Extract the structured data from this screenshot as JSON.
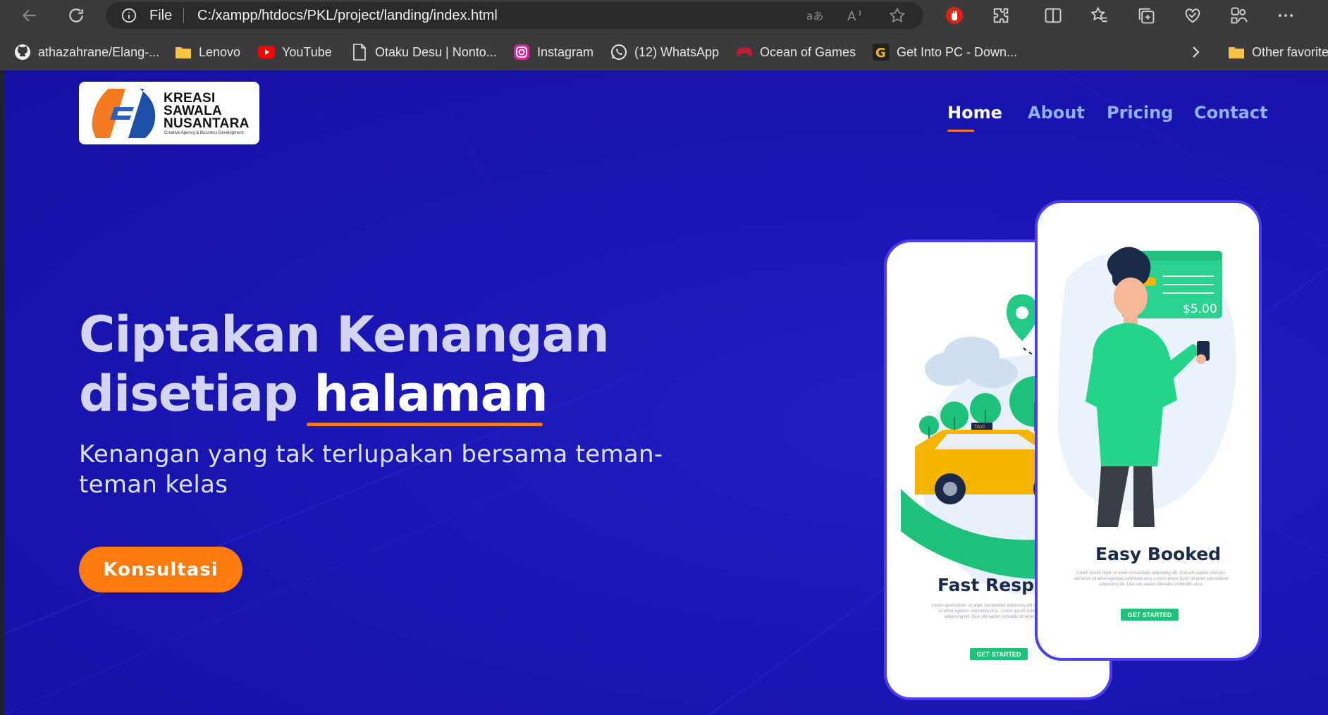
{
  "browser": {
    "protocol_label": "File",
    "url": "C:/xampp/htdocs/PKL/project/landing/index.html",
    "bookmarks": [
      {
        "label": "athazahrane/Elang-...",
        "icon": "github-icon"
      },
      {
        "label": "Lenovo",
        "icon": "folder-icon"
      },
      {
        "label": "YouTube",
        "icon": "youtube-icon"
      },
      {
        "label": "Otaku Desu | Nonto...",
        "icon": "page-icon"
      },
      {
        "label": "Instagram",
        "icon": "instagram-icon"
      },
      {
        "label": "(12) WhatsApp",
        "icon": "whatsapp-icon"
      },
      {
        "label": "Ocean of Games",
        "icon": "gamepad-icon"
      },
      {
        "label": "Get Into PC - Down...",
        "icon": "getintopc-icon"
      }
    ],
    "other_favorites": "Other favorite"
  },
  "site": {
    "logo": {
      "line1": "KREASI",
      "line2": "SAWALA",
      "line3": "NUSANTARA",
      "tagline": "Creative Agency & Business Development"
    },
    "nav": [
      {
        "label": "Home",
        "active": true
      },
      {
        "label": "About",
        "active": false
      },
      {
        "label": "Pricing",
        "active": false
      },
      {
        "label": "Contact",
        "active": false
      }
    ],
    "hero": {
      "title_line1": "Ciptakan Kenangan",
      "title_line2_prefix": "disetiap ",
      "title_line2_highlight": "halaman",
      "subtitle": "Kenangan yang tak terlupakan bersama teman-teman kelas",
      "cta_label": "Konsultasi"
    },
    "phones": {
      "back": {
        "title": "Fast Respon",
        "body": "Lorem ipsum dolor sit amet consectetur adipiscing elit sapien convallis sed enim sit amet egestas commodo arcu. Lorem ipsum dolor sit amet consectetur adipiscing elit. Duis elit sapien convallis sit amet ut commodo arcu.",
        "button": "GET STARTED",
        "taxi_sign": "TAXI"
      },
      "front": {
        "title": "Easy Booked",
        "body": "Lorem ipsum dolor sit amet consectetur adipiscing elit. Duis elit sapien convallis sed enim sit amet egestas commodo arcu. Lorem ipsum dolor sit amet consectetur adipiscing elit. Duis elit sapien convallis commodo arcu.",
        "button": "GET STARTED",
        "price": "$5.00"
      }
    }
  },
  "colors": {
    "page_bg": "#1a16b4",
    "accent_orange": "#ff7a0f",
    "nav_inactive": "#8fb1ff",
    "button_green": "#20c17a"
  }
}
